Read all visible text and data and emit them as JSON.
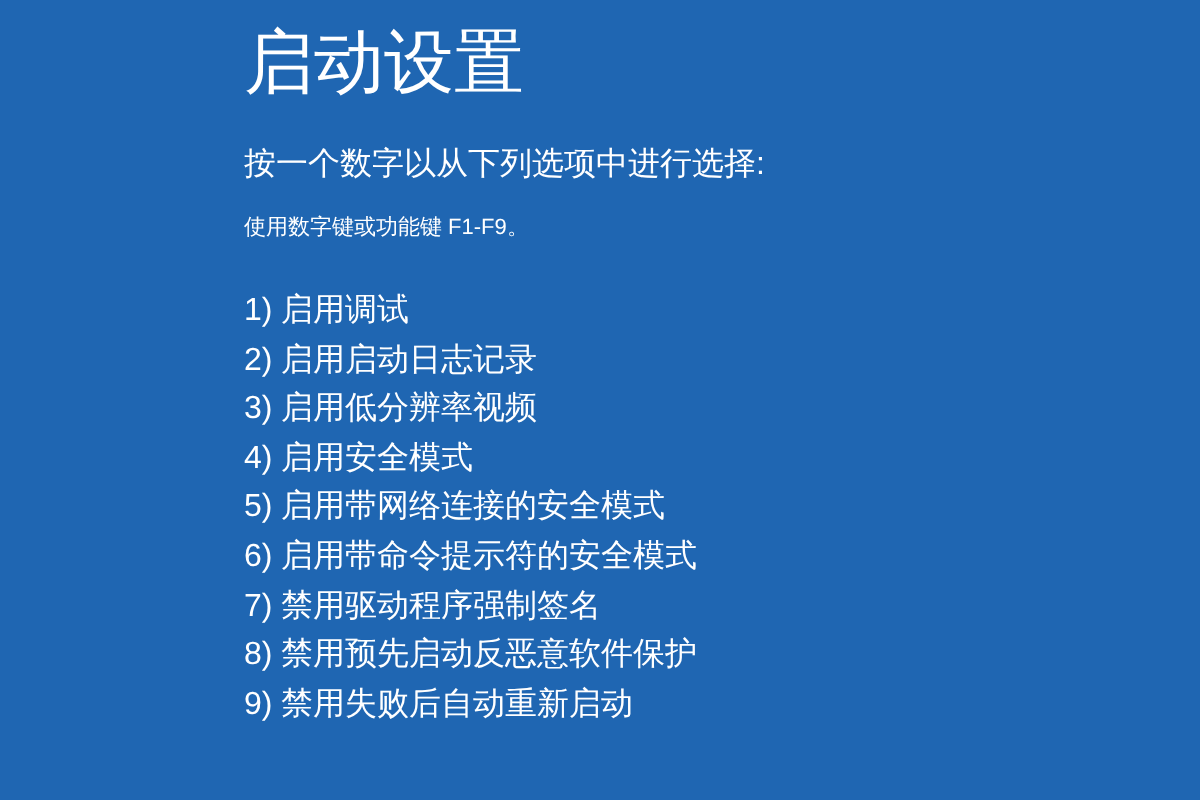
{
  "title": "启动设置",
  "prompt": "按一个数字以从下列选项中进行选择:",
  "hint": "使用数字键或功能键 F1-F9。",
  "options": [
    {
      "label": "1) 启用调试"
    },
    {
      "label": "2) 启用启动日志记录"
    },
    {
      "label": "3) 启用低分辨率视频"
    },
    {
      "label": "4) 启用安全模式"
    },
    {
      "label": "5) 启用带网络连接的安全模式"
    },
    {
      "label": "6) 启用带命令提示符的安全模式"
    },
    {
      "label": "7) 禁用驱动程序强制签名"
    },
    {
      "label": "8) 禁用预先启动反恶意软件保护"
    },
    {
      "label": "9) 禁用失败后自动重新启动"
    }
  ]
}
